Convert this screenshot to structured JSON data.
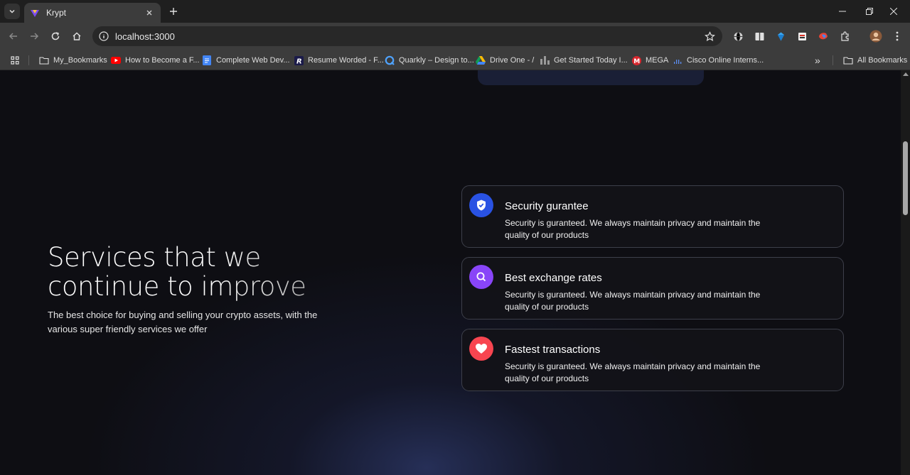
{
  "browser": {
    "tab_title": "Krypt",
    "url": "localhost:3000",
    "bookmarks": [
      {
        "label": "My_Bookmarks",
        "icon": "folder-icon"
      },
      {
        "label": "How to Become a F...",
        "icon": "youtube-icon"
      },
      {
        "label": "Complete Web Dev...",
        "icon": "docs-icon"
      },
      {
        "label": "Resume Worded - F...",
        "icon": "resume-worded-icon"
      },
      {
        "label": "Quarkly – Design to...",
        "icon": "quarkly-icon"
      },
      {
        "label": "Drive One - /",
        "icon": "drive-icon"
      },
      {
        "label": "Get Started Today I...",
        "icon": "get-started-icon"
      },
      {
        "label": "MEGA",
        "icon": "mega-icon"
      },
      {
        "label": "Cisco Online Interns...",
        "icon": "cisco-icon"
      }
    ],
    "all_bookmarks_label": "All Bookmarks",
    "overflow_label": "»"
  },
  "hero": {
    "title_line1": "Services that we",
    "title_line2": "continue to improve",
    "subtitle": "The best choice for buying and selling your crypto assets, with the various super friendly services we offer"
  },
  "services": [
    {
      "title": "Security gurantee",
      "description": "Security is guranteed. We always maintain privacy and maintain the quality of our products",
      "color": "#2952e3",
      "icon": "shield-check-icon"
    },
    {
      "title": "Best exchange rates",
      "description": "Security is guranteed. We always maintain privacy and maintain the quality of our products",
      "color": "#8945f8",
      "icon": "search-icon"
    },
    {
      "title": "Fastest transactions",
      "description": "Security is guranteed. We always maintain privacy and maintain the quality of our products",
      "color": "#f84550",
      "icon": "heart-icon"
    }
  ],
  "colors": {
    "page_bg": "#0e0e13",
    "card_border": "#3d3f4a",
    "chrome_bg": "#3c3c3c"
  }
}
